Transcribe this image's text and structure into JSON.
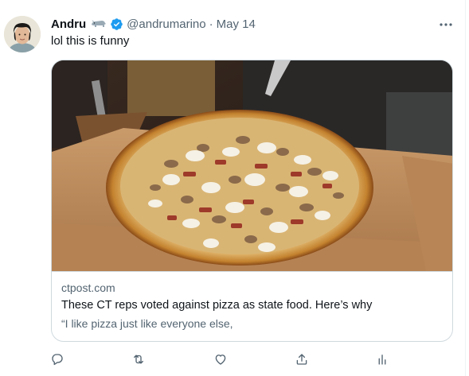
{
  "tweet": {
    "display_name": "Andru",
    "handle": "@andrumarino",
    "separator": "·",
    "date": "May 14",
    "text": "lol this is funny",
    "name_emoji": "rhino-emoji",
    "verified_icon": "verified-badge-icon"
  },
  "card": {
    "domain": "ctpost.com",
    "title": "These CT reps voted against pizza as state food. Here’s why",
    "description": "“I like pizza just like everyone else,"
  },
  "actions": [
    "reply-icon",
    "retweet-icon",
    "like-icon",
    "share-icon",
    "analytics-icon"
  ],
  "colors": {
    "text": "#0f1419",
    "secondary": "#536471",
    "verified": "#1d9bf0",
    "border": "#cfd9de"
  }
}
